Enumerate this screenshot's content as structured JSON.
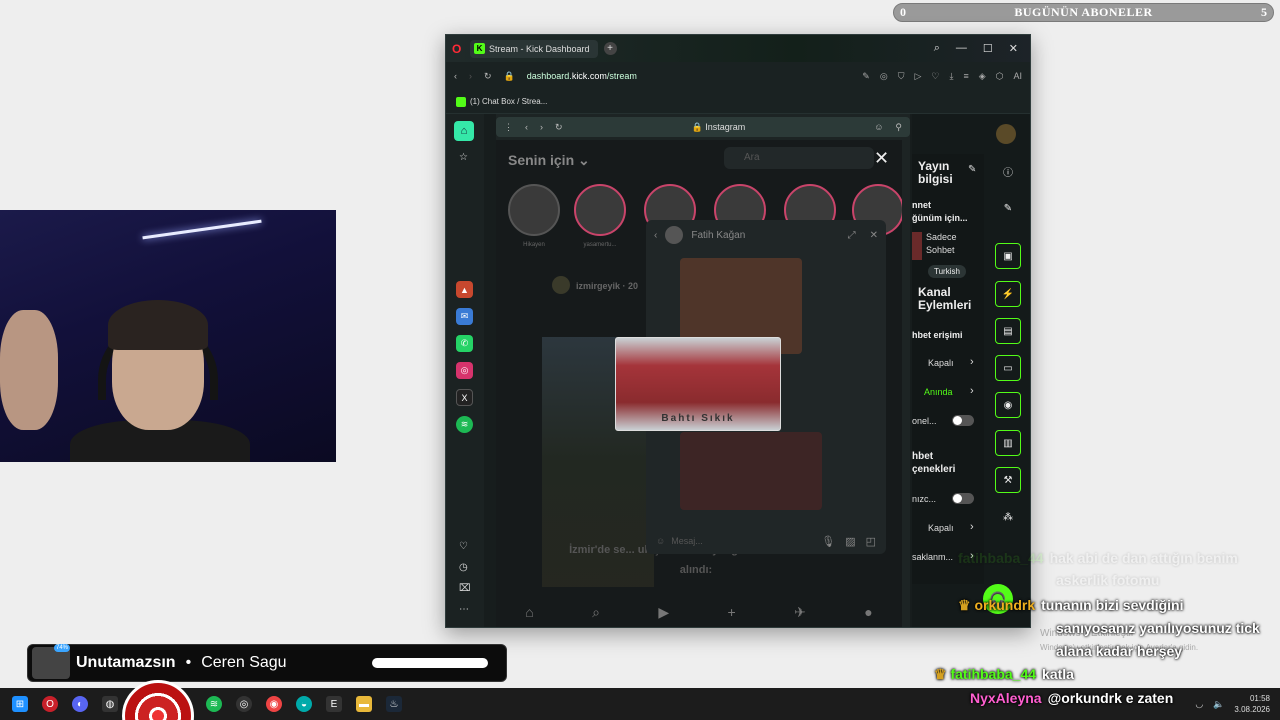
{
  "subs": {
    "left": "0",
    "title": "BUGÜNÜN ABONELER",
    "right": "5"
  },
  "browser": {
    "tab_title": "Stream - Kick Dashboard",
    "url_pre": "dashboard.",
    "url_domain": "kick.com",
    "url_post": "/stream",
    "bookmark": "(1) Chat Box / Strea...",
    "ai_label": "AI"
  },
  "instagram": {
    "addr": "Instagram",
    "header": "Senin için",
    "search_placeholder": "Ara",
    "stories": [
      "Hikayen",
      "yasamertu..."
    ],
    "post_user": "izmirgeyik",
    "post_time": "20",
    "caption": "İzmir'de se... ulaşan orman yangını kontrol altına alındı:",
    "dm": {
      "name": "Fatih Kağan",
      "placeholder": "Mesaj...",
      "meme_text": "Bahtı Sıkık"
    }
  },
  "kick_panel": {
    "title1": "Yayın",
    "title2": "bilgisi",
    "row1": "nnet",
    "row2": "ğünüm için...",
    "category1": "Sadece",
    "category2": "Sohbet",
    "language": "Turkish",
    "actions1": "Kanal",
    "actions2": "Eylemleri",
    "chat_access": "hbet erişimi",
    "closed": "Kapalı",
    "instant": "Anında",
    "onel": "onel...",
    "options1": "hbet",
    "options2": "çenekleri",
    "nizc": "nızc...",
    "closed2": "Kapalı",
    "saklan": "saklanm..."
  },
  "now_playing": {
    "percent": "74%",
    "title": "Unutamazsın",
    "separator": "•",
    "artist": "Ceren Sagu"
  },
  "chat": [
    {
      "nick": "fatihbaba_44",
      "msg": "hak abi de dan attığın benim",
      "faded": true
    },
    {
      "nick": "",
      "msg": "askerlik fotomu",
      "faded": true
    },
    {
      "nick": "orkundrk",
      "msg": "tunanın bizi sevdiğini"
    },
    {
      "nick": "",
      "msg": "sanıyosanız yanılıyosunuz tick"
    },
    {
      "nick": "",
      "msg": "alana kadar herşey"
    },
    {
      "nick": "fatihbaba_44",
      "msg": "katla"
    },
    {
      "nick": "NyxAleyna",
      "msg": "@orkundrk e zaten"
    }
  ],
  "windows_watermark": [
    "Windows'u Etkinleştir",
    "Windows'u etkinleştirmek için Ayarlar'a gidin."
  ],
  "taskbar": {
    "time": "01:58",
    "date": "3.08.2026"
  },
  "colors": {
    "kick_green": "#53fc18",
    "nick_orkundrk": "#f0b020",
    "nick_fatih": "#53fc18",
    "nick_nyx": "#ff5fd0"
  }
}
